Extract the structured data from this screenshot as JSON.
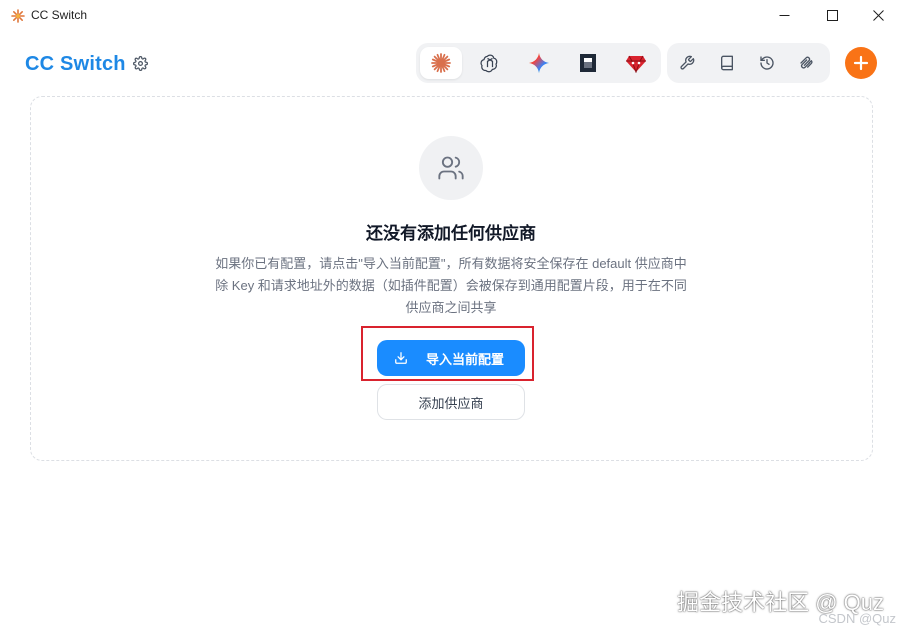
{
  "window": {
    "title": "CC Switch"
  },
  "header": {
    "brand": "CC Switch"
  },
  "icons": {
    "settings": "gear-icon",
    "tab_claude": "claude-icon",
    "tab_codex": "openai-icon",
    "tab_gemini": "gemini-icon",
    "tab_opencode": "opencode-icon",
    "tab_ruby": "ruby-icon",
    "tool_wrench": "wrench-icon",
    "tool_book": "book-icon",
    "tool_history": "history-icon",
    "tool_mcp": "mcp-icon",
    "add": "plus-icon",
    "empty_state": "users-icon",
    "import": "download-icon"
  },
  "colors": {
    "brand": "#1e88e5",
    "primary": "#1a8cff",
    "add_button": "#f97316",
    "highlight": "#d9232e"
  },
  "empty_state": {
    "title": "还没有添加任何供应商",
    "description_lines": [
      "如果你已有配置，请点击\"导入当前配置\"，所有数据将安全保存在 default 供应商中",
      "除 Key 和请求地址外的数据（如插件配置）会被保存到通用配置片段，用于在不同",
      "供应商之间共享"
    ],
    "import_button": "导入当前配置",
    "add_provider_button": "添加供应商"
  },
  "watermark": {
    "main": "掘金技术社区 @ Quz",
    "sub": "CSDN @Quz"
  }
}
